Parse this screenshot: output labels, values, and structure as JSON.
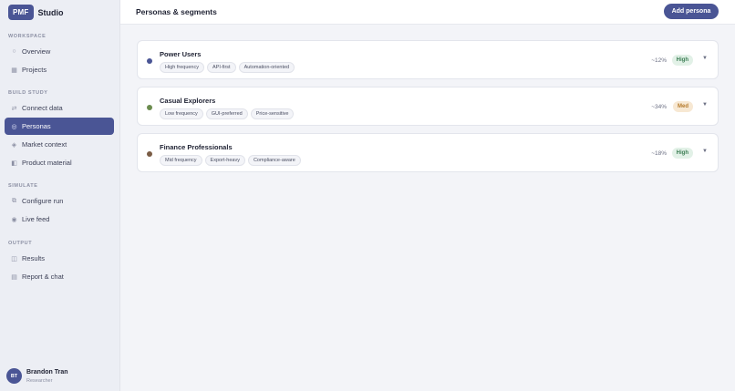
{
  "brand": {
    "badge": "PMF",
    "name": "Studio"
  },
  "sidebar": {
    "sections": [
      {
        "label": "WORKSPACE"
      },
      {
        "label": "BUILD STUDY"
      },
      {
        "label": "SIMULATE"
      },
      {
        "label": "OUTPUT"
      }
    ],
    "items": [
      {
        "label": "Overview",
        "icon": "circle-icon"
      },
      {
        "label": "Projects",
        "icon": "square-icon"
      },
      {
        "label": "Connect data",
        "icon": "arrows-icon"
      },
      {
        "label": "Personas",
        "icon": "persona-icon",
        "active": true
      },
      {
        "label": "Market context",
        "icon": "diamond-icon"
      },
      {
        "label": "Product material",
        "icon": "document-icon"
      },
      {
        "label": "Configure run",
        "icon": "configure-icon"
      },
      {
        "label": "Live feed",
        "icon": "radio-icon"
      },
      {
        "label": "Results",
        "icon": "chart-icon"
      },
      {
        "label": "Report & chat",
        "icon": "report-icon"
      }
    ]
  },
  "user": {
    "initials": "BT",
    "name": "Brandon Tran",
    "role": "Researcher"
  },
  "header": {
    "title": "Personas & segments",
    "add_button": "Add persona"
  },
  "personas": [
    {
      "name": "Power Users",
      "color": "#4a5595",
      "tags": [
        "High frequency",
        "API-first",
        "Automation-oriented"
      ],
      "share": "~12%",
      "level": "High"
    },
    {
      "name": "Casual Explorers",
      "color": "#6b8c4e",
      "tags": [
        "Low frequency",
        "GUI-preferred",
        "Price-sensitive"
      ],
      "share": "~34%",
      "level": "Med"
    },
    {
      "name": "Finance Professionals",
      "color": "#7a5c45",
      "tags": [
        "Mid frequency",
        "Export-heavy",
        "Compliance-aware"
      ],
      "share": "~18%",
      "level": "High"
    }
  ],
  "colors": {
    "accent": "#4a5595",
    "high": "#3b7d53",
    "med": "#b57a2c"
  }
}
